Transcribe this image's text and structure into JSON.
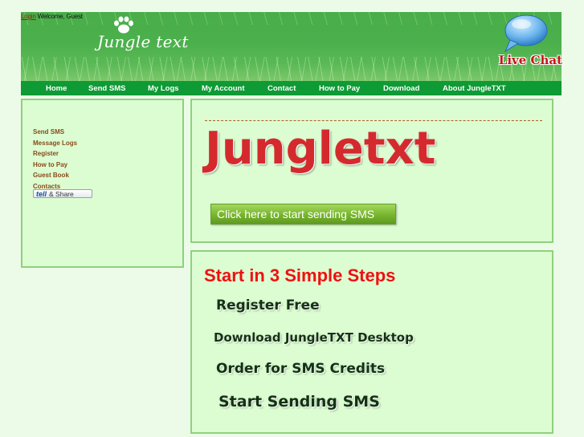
{
  "login_bar": {
    "login_link": "Login",
    "welcome": "Welcome, Guest"
  },
  "header": {
    "logo_text": "Jungle text",
    "live_chat_label": "Live Chat"
  },
  "nav": {
    "items": [
      {
        "label": "Home"
      },
      {
        "label": "Send SMS"
      },
      {
        "label": "My Logs"
      },
      {
        "label": "My Account"
      },
      {
        "label": "Contact"
      },
      {
        "label": "How to Pay"
      },
      {
        "label": "Download"
      },
      {
        "label": "About JungleTXT"
      }
    ]
  },
  "sidebar": {
    "links": [
      {
        "label": "Send SMS"
      },
      {
        "label": "Message Logs"
      },
      {
        "label": "Register"
      },
      {
        "label": "How to Pay"
      },
      {
        "label": "Guest Book"
      },
      {
        "label": "Contacts"
      }
    ],
    "tell_share": {
      "tell": "tell",
      "share": "& Share"
    }
  },
  "hero": {
    "brand": "Jungletxt",
    "cta_label": "Click here to start sending SMS"
  },
  "steps": {
    "title": "Start in 3 Simple Steps",
    "items": [
      {
        "label": "Register Free"
      },
      {
        "label": "Download JungleTXT Desktop"
      },
      {
        "label": "Order for SMS Credits"
      },
      {
        "label": "Start Sending SMS"
      }
    ]
  },
  "colors": {
    "page_bg": "#ebfbe8",
    "nav_bg": "#0e9a35",
    "panel_bg": "#dcfdd2",
    "panel_border": "#8fd17c",
    "sidebar_link": "#8a4a1a",
    "steps_title": "#ee1111",
    "brand_red": "#d42a2e"
  }
}
